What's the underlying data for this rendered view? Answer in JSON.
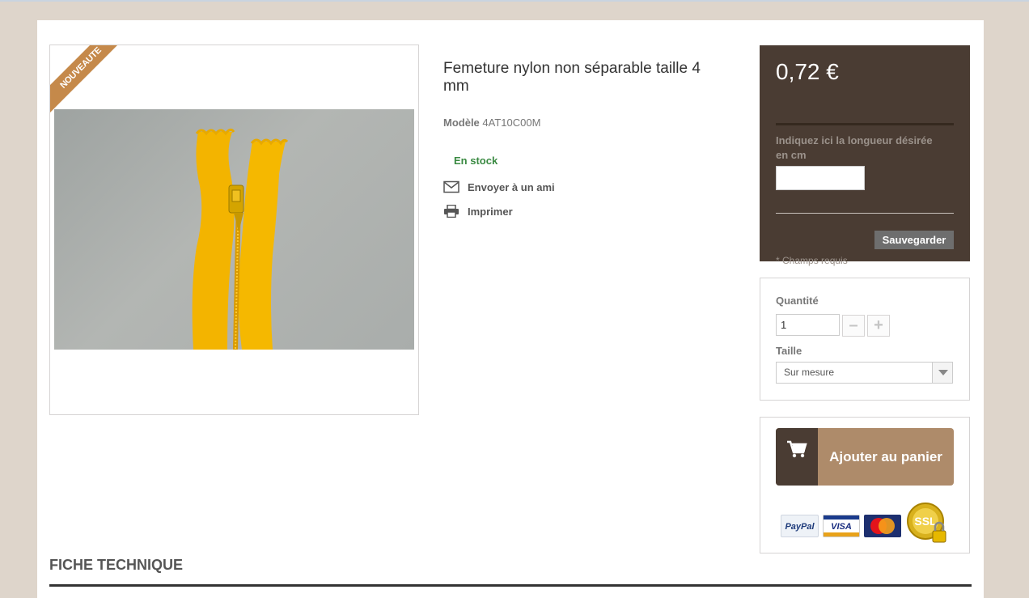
{
  "product": {
    "ribbon": "NOUVEAUTE",
    "title": "Femeture nylon non séparable taille 4 mm",
    "model_label": "Modèle",
    "model_value": "4AT10C00M",
    "stock": "En stock",
    "send_friend": "Envoyer à un ami",
    "print": "Imprimer"
  },
  "price_box": {
    "price": "0,72 €",
    "length_label": "Indiquez ici la longueur désirée en cm",
    "length_value": "",
    "save_label": "Sauvegarder",
    "required_note": "* Champs requis"
  },
  "options": {
    "qty_label": "Quantité",
    "qty_value": "1",
    "minus": "–",
    "plus": "+",
    "size_label": "Taille",
    "size_value": "Sur mesure"
  },
  "cart": {
    "add_label": "Ajouter au panier",
    "payments": [
      "PayPal",
      "VISA",
      "MasterCard",
      "SSL"
    ]
  },
  "section": {
    "fiche_title": "FICHE TECHNIQUE"
  },
  "colors": {
    "ribbon": "#c5894a",
    "price_bg": "#4a3c33",
    "cart_btn": "#ae8b6a",
    "stock_green": "#3a8a42",
    "zipper": "#f2b705"
  }
}
